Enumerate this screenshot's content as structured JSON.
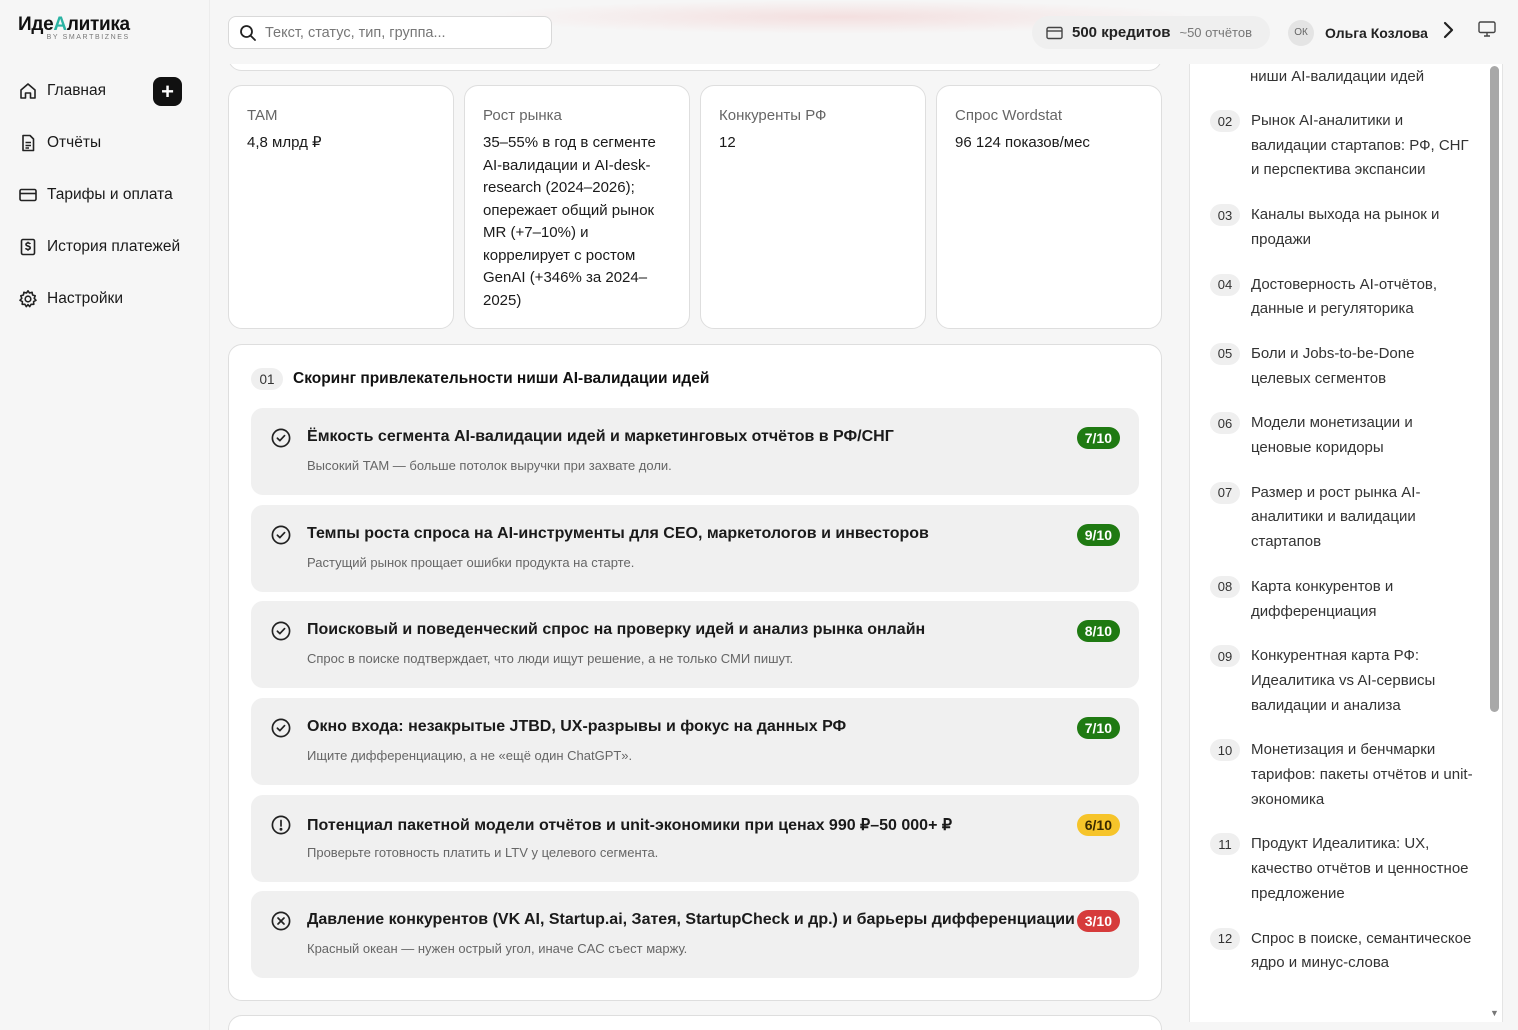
{
  "logo": {
    "main_a": "Иде",
    "main_accent": "А",
    "main_b": "литика",
    "sub": "BY SMARTBIZNES"
  },
  "sidebar": {
    "items": [
      {
        "label": "Главная",
        "icon": "home-icon"
      },
      {
        "label": "Отчёты",
        "icon": "document-icon"
      },
      {
        "label": "Тарифы и оплата",
        "icon": "credit-card-icon"
      },
      {
        "label": "История платежей",
        "icon": "dollar-receipt-icon"
      },
      {
        "label": "Настройки",
        "icon": "gear-icon"
      }
    ],
    "add_label": "+"
  },
  "topbar": {
    "search_placeholder": "Текст, статус, тип, группа...",
    "credits_amount": "500 кредитов",
    "credits_reports": "~50 отчётов",
    "user_initials": "ОК",
    "user_name": "Ольга Козлова",
    "chevron": "›"
  },
  "kpis": [
    {
      "label": "TAM",
      "value": "4,8 млрд ₽"
    },
    {
      "label": "Рост рынка",
      "value": "35–55% в год в сегменте AI-валидации и AI-desk-research (2024–2026); опережает общий рынок MR (+7–10%) и коррелирует с ростом GenAI (+346% за 2024–2025)"
    },
    {
      "label": "Конкуренты РФ",
      "value": "12"
    },
    {
      "label": "Спрос Wordstat",
      "value": "96 124 показов/мес"
    }
  ],
  "section": {
    "number": "01",
    "title": "Скоринг привлекательности ниши AI-валидации идей",
    "items": [
      {
        "title": "Ёмкость сегмента AI-валидации идей и маркетинговых отчётов в РФ/СНГ",
        "desc": "Высокий TAM — больше потолок выручки при захвате доли.",
        "score": "7/10",
        "level": "green",
        "icon": "check-circle-icon"
      },
      {
        "title": "Темпы роста спроса на AI-инструменты для CEO, маркетологов и инвесторов",
        "desc": "Растущий рынок прощает ошибки продукта на старте.",
        "score": "9/10",
        "level": "green",
        "icon": "check-circle-icon"
      },
      {
        "title": "Поисковый и поведенческий спрос на проверку идей и анализ рынка онлайн",
        "desc": "Спрос в поиске подтверждает, что люди ищут решение, а не только СМИ пишут.",
        "score": "8/10",
        "level": "green",
        "icon": "check-circle-icon"
      },
      {
        "title": "Окно входа: незакрытые JTBD, UX-разрывы и фокус на данных РФ",
        "desc": "Ищите дифференциацию, а не «ещё один ChatGPT».",
        "score": "7/10",
        "level": "green",
        "icon": "check-circle-icon"
      },
      {
        "title": "Потенциал пакетной модели отчётов и unit-экономики при ценах 990 ₽–50 000+ ₽",
        "desc": "Проверьте готовность платить и LTV у целевого сегмента.",
        "score": "6/10",
        "level": "yellow",
        "icon": "alert-circle-icon"
      },
      {
        "title": "Давление конкурентов (VK AI, Startup.ai, Затея, StartupCheck и др.) и барьеры дифференциации",
        "desc": "Красный океан — нужен острый угол, иначе CAC съест маржу.",
        "score": "3/10",
        "level": "red",
        "icon": "x-circle-icon"
      }
    ]
  },
  "toc": {
    "first_partial": "ниши AI-валидации идей",
    "items": [
      {
        "num": "02",
        "label": "Рынок AI-аналитики и валидации стартапов: РФ, СНГ и перспектива экспансии"
      },
      {
        "num": "03",
        "label": "Каналы выхода на рынок и продажи"
      },
      {
        "num": "04",
        "label": "Достоверность AI-отчётов, данные и регуляторика"
      },
      {
        "num": "05",
        "label": "Боли и Jobs-to-be-Done целевых сегментов"
      },
      {
        "num": "06",
        "label": "Модели монетизации и ценовые коридоры"
      },
      {
        "num": "07",
        "label": "Размер и рост рынка AI-аналитики и валидации стартапов"
      },
      {
        "num": "08",
        "label": "Карта конкурентов и дифференциация"
      },
      {
        "num": "09",
        "label": "Конкурентная карта РФ: Идеалитика vs AI-сервисы валидации и анализа"
      },
      {
        "num": "10",
        "label": "Монетизация и бенчмарки тарифов: пакеты отчётов и unit-экономика"
      },
      {
        "num": "11",
        "label": "Продукт Идеалитика: UX, качество отчётов и ценностное предложение"
      },
      {
        "num": "12",
        "label": "Спрос в поиске, семантическое ядро и минус-слова"
      }
    ]
  },
  "colors": {
    "score_green": "#1f7a12",
    "score_yellow": "#f6c42a",
    "score_red": "#d63b3b",
    "logo_accent": "#2bb3a3"
  }
}
